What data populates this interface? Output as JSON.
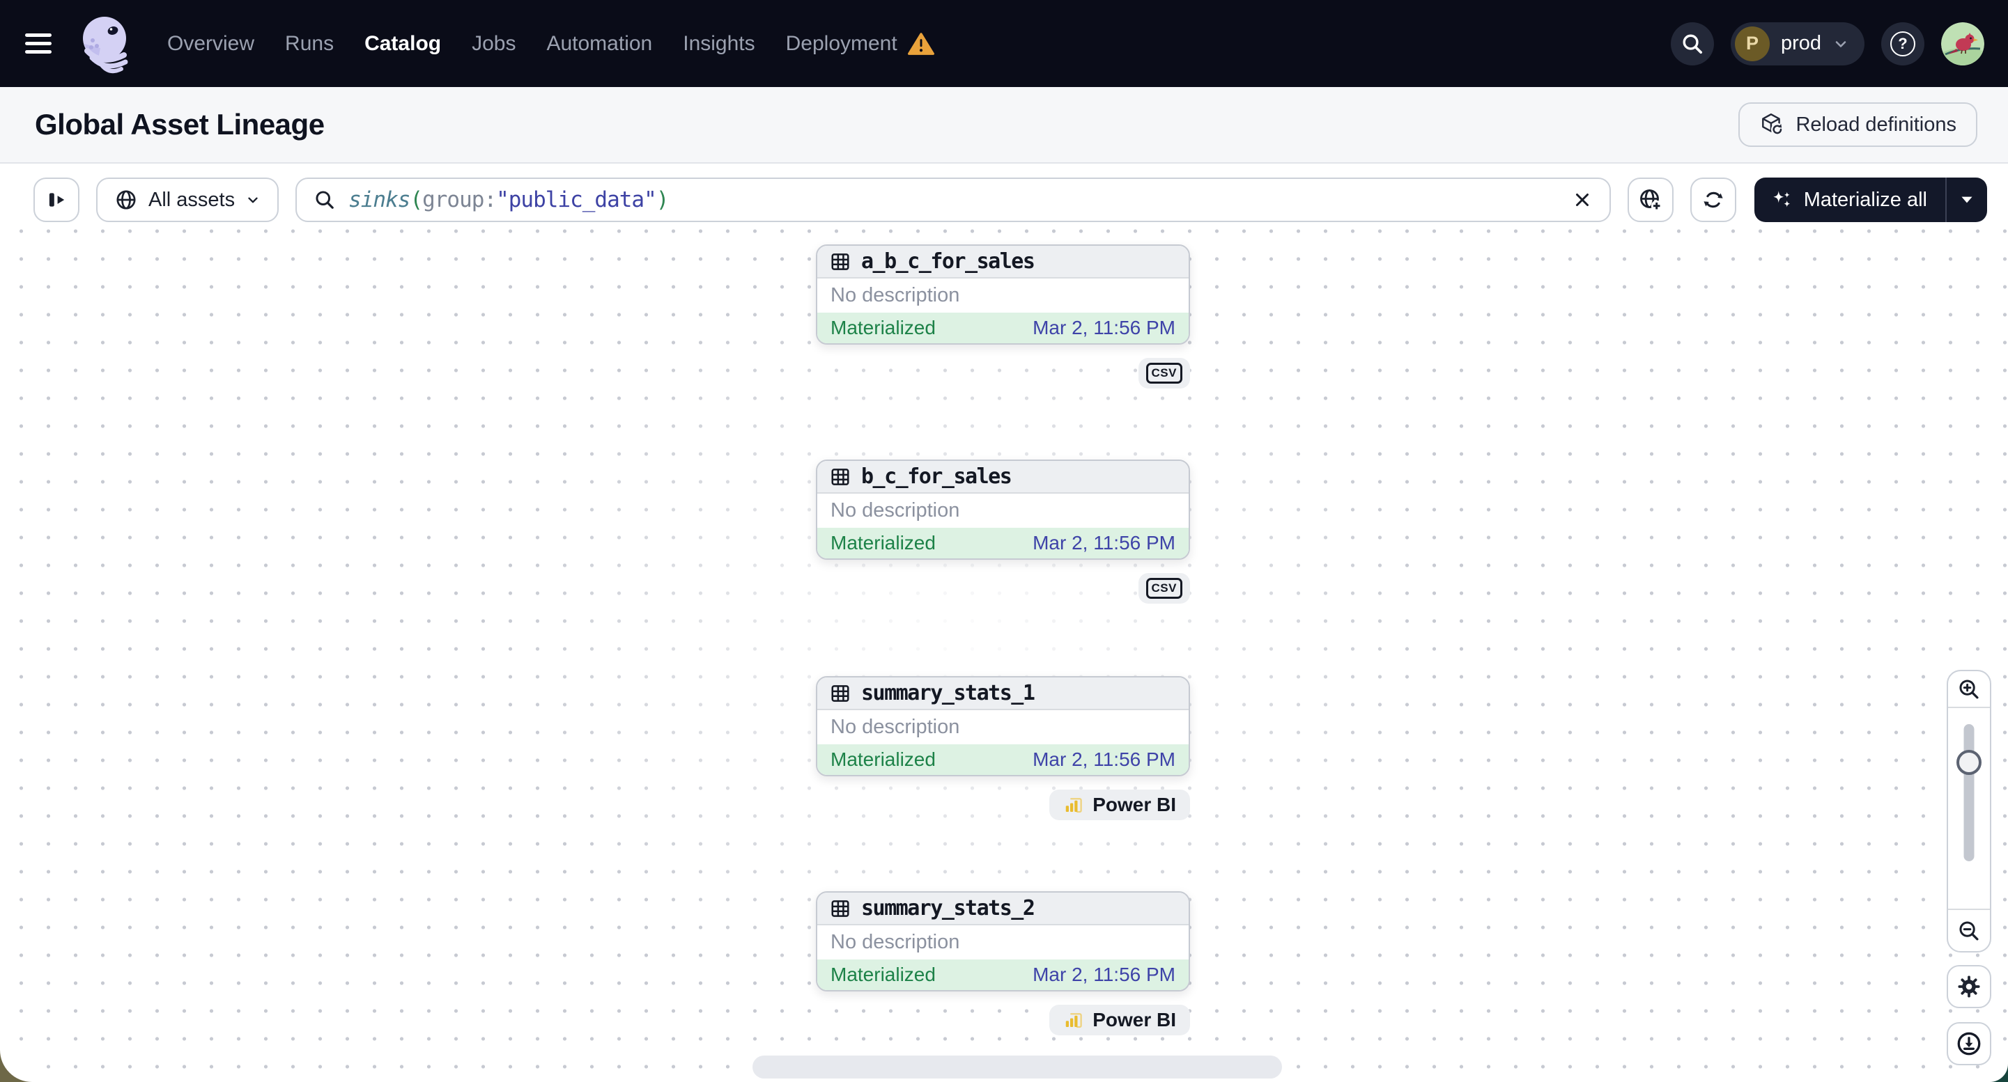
{
  "nav": {
    "items": [
      {
        "label": "Overview"
      },
      {
        "label": "Runs"
      },
      {
        "label": "Catalog",
        "active": true
      },
      {
        "label": "Jobs"
      },
      {
        "label": "Automation"
      },
      {
        "label": "Insights"
      },
      {
        "label": "Deployment",
        "warning": true
      }
    ],
    "environment": {
      "initial": "P",
      "name": "prod"
    }
  },
  "header": {
    "title": "Global Asset Lineage",
    "reload_label": "Reload definitions"
  },
  "toolbar": {
    "scope_label": "All assets",
    "materialize_label": "Materialize all",
    "query": {
      "function": "sinks",
      "paren_open": "(",
      "key": "group",
      "colon": ":",
      "value": "\"public_data\"",
      "paren_close": ")"
    }
  },
  "graph": {
    "nodes": [
      {
        "name": "a_b_c_for_sales",
        "description": "No description",
        "status": "Materialized",
        "timestamp": "Mar 2, 11:56 PM",
        "tag": "CSV",
        "tag_kind": "csv"
      },
      {
        "name": "b_c_for_sales",
        "description": "No description",
        "status": "Materialized",
        "timestamp": "Mar 2, 11:56 PM",
        "tag": "CSV",
        "tag_kind": "csv"
      },
      {
        "name": "summary_stats_1",
        "description": "No description",
        "status": "Materialized",
        "timestamp": "Mar 2, 11:56 PM",
        "tag": "Power BI",
        "tag_kind": "powerbi"
      },
      {
        "name": "summary_stats_2",
        "description": "No description",
        "status": "Materialized",
        "timestamp": "Mar 2, 11:56 PM",
        "tag": "Power BI",
        "tag_kind": "powerbi"
      }
    ]
  },
  "colors": {
    "nav-bg": "#0a0c18",
    "nav-chip-bg": "#232838",
    "page-bg": "#f6f7f9",
    "border": "#ccd1d9",
    "text-dark": "#1a1f2b",
    "muted": "#9ba1b0",
    "dot": "#c7cad2",
    "node-header-bg": "#edeff2",
    "desc-gray": "#8b919f",
    "success-bg": "#ddf2e3",
    "success-text": "#1d8248",
    "timestamp-indigo": "#3e43a8",
    "tag-bg": "#edeff2",
    "dark-button-bg": "#131829",
    "warning-orange": "#e9a23b",
    "query-fn": "#4c7e90",
    "query-paren": "#2f8652",
    "query-key": "#7d8594",
    "query-value": "#3d42a4",
    "prod-avatar-bg": "#6b5a26",
    "slider-track": "#c3c7cf",
    "corner-olive": "#6e6847",
    "corner-teal": "#17453d",
    "powerbi-yellow": "#e9bc2f"
  }
}
